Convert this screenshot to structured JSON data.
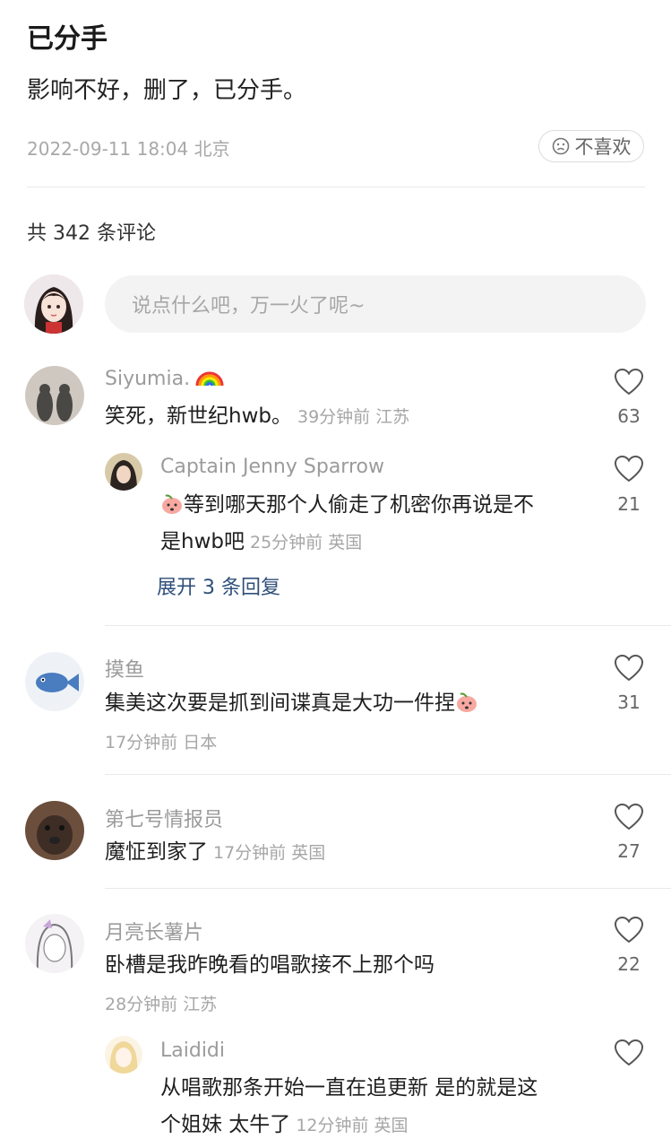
{
  "post": {
    "title": "已分手",
    "content": "影响不好，删了，已分手。",
    "meta": "2022-09-11 18:04 北京",
    "dislike_label": "不喜欢"
  },
  "comments_count": "共 342 条评论",
  "input_placeholder": "说点什么吧，万一火了呢~",
  "comments": [
    {
      "user": "Siyumia.",
      "text": "笑死，新世纪hwb。",
      "time": "39分钟前 江苏",
      "likes": "63"
    },
    {
      "user": "Captain Jenny Sparrow",
      "text1": "等到哪天那个人偷走了机密你再说是不",
      "text2": "是hwb吧",
      "time": "25分钟前 英国",
      "likes": "21",
      "expand": "展开 3 条回复"
    },
    {
      "user": "摸鱼",
      "text": "集美这次要是抓到间谍真是大功一件捏",
      "time": "17分钟前 日本",
      "likes": "31"
    },
    {
      "user": "第七号情报员",
      "text": "魔怔到家了",
      "time": "17分钟前 英国",
      "likes": "27"
    },
    {
      "user": "月亮长薯片",
      "text": "卧槽是我昨晚看的唱歌接不上那个吗",
      "time": "28分钟前 江苏",
      "likes": "22"
    },
    {
      "user": "Laididi",
      "text1": "从唱歌那条开始一直在追更新 是的就是这",
      "text2": "个姐妹 太牛了",
      "time": "12分钟前 英国"
    }
  ],
  "icons": {
    "heart": "heart-icon",
    "dislike": "sad-face-icon",
    "rainbow": "rainbow-emoji-icon",
    "peach": "peach-emoji-icon"
  }
}
